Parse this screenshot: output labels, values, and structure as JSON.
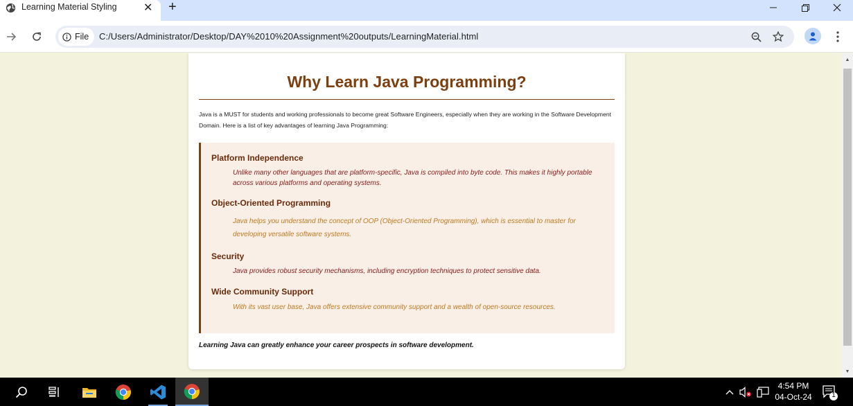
{
  "browser": {
    "tab_title": "Learning Material Styling",
    "new_tab_label": "+",
    "site_chip_label": "File",
    "url": "C:/Users/Administrator/Desktop/DAY%2010%20Assignment%20outputs/LearningMaterial.html"
  },
  "page": {
    "title": "Why Learn Java Programming?",
    "intro": "Java is a MUST for students and working professionals to become great Software Engineers, especially when they are working in the Software Development Domain. Here is a list of key advantages of learning Java Programming:",
    "features": [
      {
        "title": "Platform Independence",
        "description": "Unlike many other languages that are platform-specific, Java is compiled into byte code. This makes it highly portable across various platforms and operating systems."
      },
      {
        "title": "Object-Oriented Programming",
        "description": "Java helps you understand the concept of OOP (Object-Oriented Programming), which is essential to master for developing versatile software systems."
      },
      {
        "title": "Security",
        "description": "Java provides robust security mechanisms, including encryption techniques to protect sensitive data."
      },
      {
        "title": "Wide Community Support",
        "description": "With its vast user base, Java offers extensive community support and a wealth of open-source resources."
      }
    ],
    "closing": "Learning Java can greatly enhance your career prospects in software development."
  },
  "colors": {
    "page_background": "#f3f2dc",
    "heading": "#7b3f10",
    "panel_background": "#f9efe6",
    "description_dark": "#8b1a1a",
    "description_orange": "#c07a20"
  },
  "taskbar": {
    "time": "4:54 PM",
    "date": "04-Oct-24",
    "notification_count": "1",
    "icons": [
      "search-icon",
      "task-view-icon",
      "file-explorer-icon",
      "chrome-icon",
      "vscode-icon",
      "chrome-icon"
    ]
  }
}
